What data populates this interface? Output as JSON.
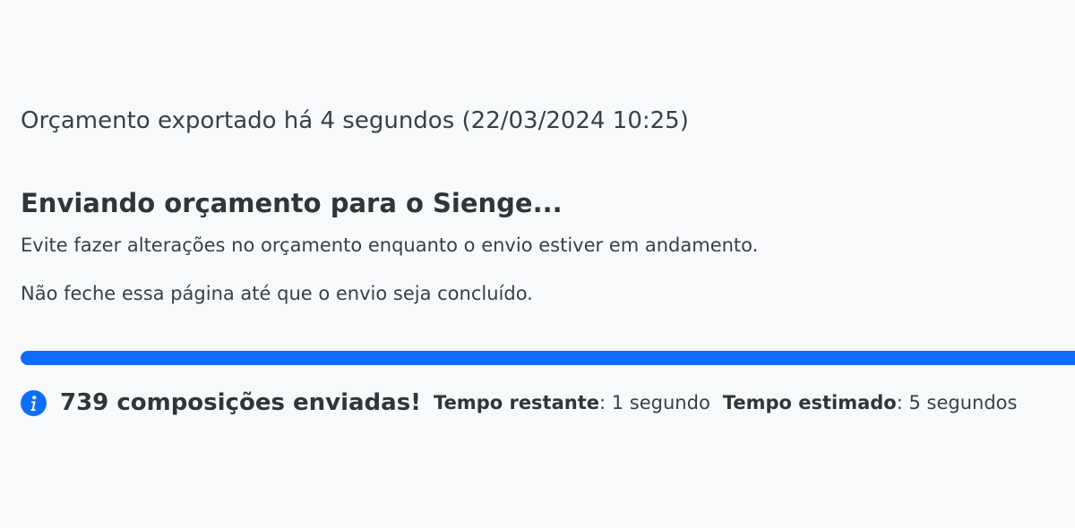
{
  "export": {
    "text": "Orçamento exportado há 4 segundos (22/03/2024 10:25)"
  },
  "sending": {
    "title": "Enviando orçamento para o Sienge...",
    "warning": "Evite fazer alterações no orçamento enquanto o envio estiver em andamento.",
    "notice": "Não feche essa página até que o envio seja concluído."
  },
  "progress": {
    "percent": 100,
    "color": "#0d6efd"
  },
  "status": {
    "icon": "info-icon",
    "count_text": "739 composições enviadas!",
    "remaining_label": "Tempo restante",
    "remaining_value": ": 1 segundo",
    "estimated_label": "Tempo estimado",
    "estimated_value": ": 5 segundos"
  }
}
